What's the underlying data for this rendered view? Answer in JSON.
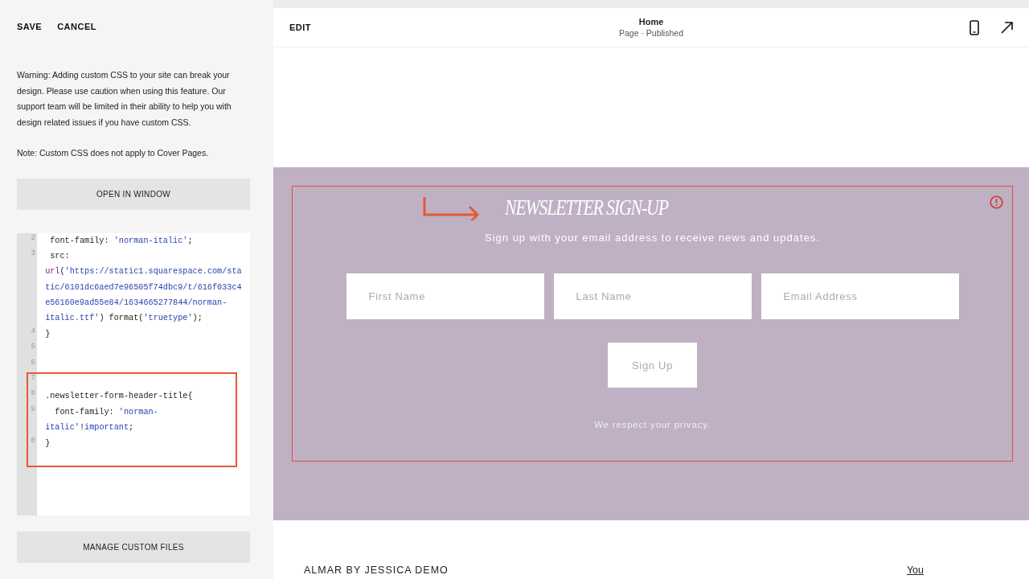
{
  "panel_actions": {
    "save": "SAVE",
    "cancel": "CANCEL"
  },
  "warning": "Warning: Adding custom CSS to your site can break your design. Please use caution when using this feature. Our support team will be limited in their ability to help you with design related issues if you have custom CSS.",
  "note": "Note: Custom CSS does not apply to Cover Pages.",
  "open_button": "OPEN IN WINDOW",
  "code_lines": [
    {
      "number": "2",
      "segments": [
        {
          "kind": "plain",
          "text": " font-family: "
        },
        {
          "kind": "string",
          "text": "'norman-italic'"
        },
        {
          "kind": "plain",
          "text": ";"
        }
      ]
    },
    {
      "number": "3",
      "segments": [
        {
          "kind": "plain",
          "text": " src:"
        }
      ]
    },
    {
      "segments": [
        {
          "kind": "keyword",
          "text": "url"
        },
        {
          "kind": "plain",
          "text": "("
        },
        {
          "kind": "string",
          "text": "'https://static1.squarespace.com/sta"
        }
      ]
    },
    {
      "segments": [
        {
          "kind": "string",
          "text": "tic/6101dc6aed7e96505f74dbc9/t/616f033c4"
        }
      ]
    },
    {
      "segments": [
        {
          "kind": "string",
          "text": "e56160e9ad55e84/1634665277844/norman-"
        }
      ]
    },
    {
      "segments": [
        {
          "kind": "string",
          "text": "italic.ttf'"
        },
        {
          "kind": "plain",
          "text": ") format("
        },
        {
          "kind": "string",
          "text": "'truetype'"
        },
        {
          "kind": "plain",
          "text": ");"
        }
      ]
    },
    {
      "number": "4",
      "segments": [
        {
          "kind": "plain",
          "text": "}"
        }
      ]
    },
    {
      "number": "5"
    },
    {
      "number": "6"
    },
    {
      "number": "7"
    },
    {
      "number": "8",
      "segments": [
        {
          "kind": "plain",
          "text": ".newsletter-form-header-title{"
        }
      ]
    },
    {
      "number": "9",
      "segments": [
        {
          "kind": "plain",
          "text": "  font-family: "
        },
        {
          "kind": "string",
          "text": "'norman-"
        }
      ]
    },
    {
      "segments": [
        {
          "kind": "string",
          "text": "italic'"
        },
        {
          "kind": "plain",
          "text": "!"
        },
        {
          "kind": "string",
          "text": "important"
        },
        {
          "kind": "plain",
          "text": ";"
        }
      ]
    },
    {
      "number": "0",
      "segments": [
        {
          "kind": "plain",
          "text": "}"
        }
      ]
    }
  ],
  "manage_button": "MANAGE CUSTOM FILES",
  "top_bar": {
    "edit": "EDIT",
    "title": "Home",
    "subtitle": "Page · Published"
  },
  "newsletter": {
    "title": "NEWSLETTER SIGN-UP",
    "description": "Sign up with your email address to receive news and updates.",
    "fields": [
      {
        "placeholder": "First Name"
      },
      {
        "placeholder": "Last Name"
      },
      {
        "placeholder": "Email Address"
      }
    ],
    "button": "Sign Up",
    "privacy": "We respect your privacy."
  },
  "footer": {
    "brand": "ALMAR BY JESSICA DEMO",
    "link": "You"
  }
}
